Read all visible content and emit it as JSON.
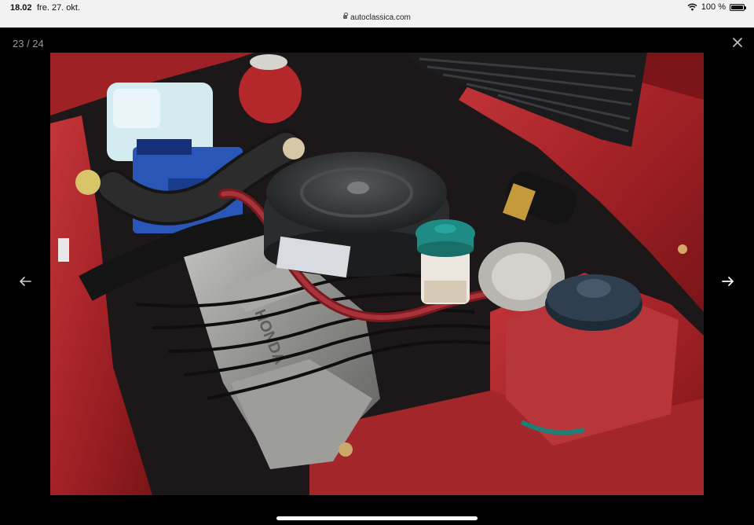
{
  "status_bar": {
    "time": "18.02",
    "date": "fre. 27. okt.",
    "url": "autoclassica.com",
    "battery_text": "100 %",
    "icons": [
      "lock-icon",
      "wifi-icon",
      "battery-icon"
    ]
  },
  "viewer": {
    "counter": "23 / 24",
    "close_icon": "close-icon",
    "prev_icon": "arrow-left-icon",
    "next_icon": "arrow-right-icon"
  },
  "photo": {
    "subject_label": "HONDA",
    "colors": {
      "body_red": "#b3262a",
      "engine_metal": "#9c9c9a",
      "air_filter": "#2b2c2e",
      "coolant_tank": "#cfe8ec",
      "reservoir_cap": "#1e8c84",
      "battery_blue": "#2a56b8"
    }
  }
}
